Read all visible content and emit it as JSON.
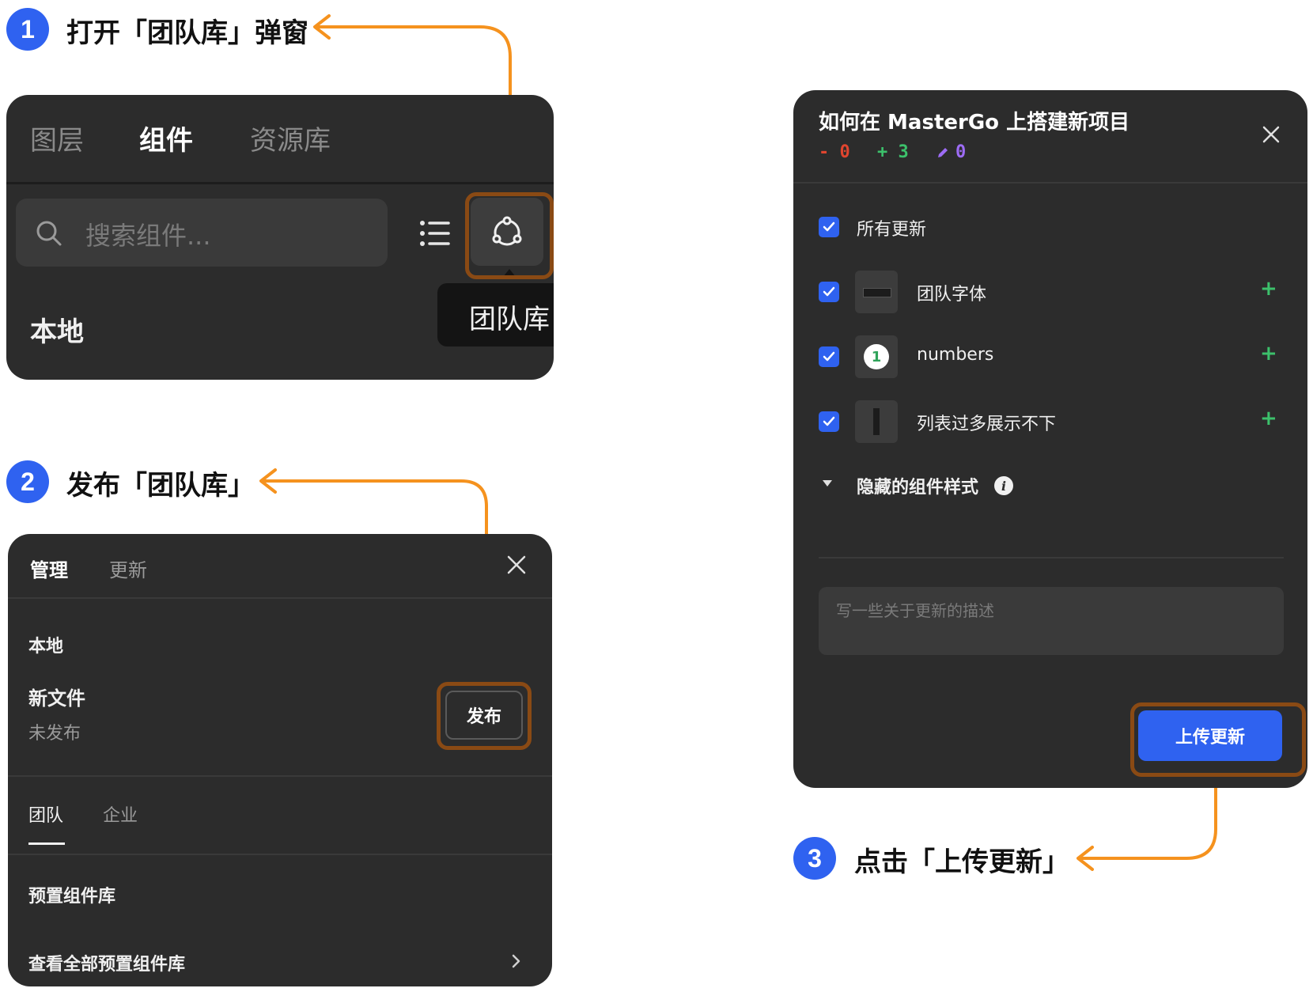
{
  "steps": {
    "s1": {
      "num": "1",
      "label": "打开「团队库」弹窗"
    },
    "s2": {
      "num": "2",
      "label": "发布「团队库」"
    },
    "s3": {
      "num": "3",
      "label": "点击「上传更新」"
    }
  },
  "panel1": {
    "tabs": [
      "图层",
      "组件",
      "资源库"
    ],
    "search_placeholder": "搜索组件...",
    "section": "本地",
    "tooltip": "团队库"
  },
  "panel2": {
    "tabs": [
      "管理",
      "更新"
    ],
    "local_label": "本地",
    "file_name": "新文件",
    "file_status": "未发布",
    "publish_button": "发布",
    "subtabs": [
      "团队",
      "企业"
    ],
    "preset": "预置组件库",
    "view_all": "查看全部预置组件库"
  },
  "panel3": {
    "title": "如何在 MasterGo 上搭建新项目",
    "stats": {
      "removed": "- 0",
      "added": "+ 3",
      "edited": "0"
    },
    "all_updates": "所有更新",
    "items": [
      {
        "label": "团队字体",
        "thumb": "text-preview"
      },
      {
        "label": "numbers",
        "thumb": "number-badge",
        "badge": "1"
      },
      {
        "label": "列表过多展示不下",
        "thumb": "list-preview"
      }
    ],
    "item_action": "+",
    "hidden_styles": "隐藏的组件样式",
    "desc_placeholder": "写一些关于更新的描述",
    "upload_button": "上传更新"
  },
  "colors": {
    "accent": "#2f62f0",
    "arrow": "#f5921e",
    "highlight": "#8a4a14",
    "panel": "#2c2c2c",
    "added": "#3cc16b",
    "removed": "#e0452f",
    "edited": "#9d6cf5"
  }
}
